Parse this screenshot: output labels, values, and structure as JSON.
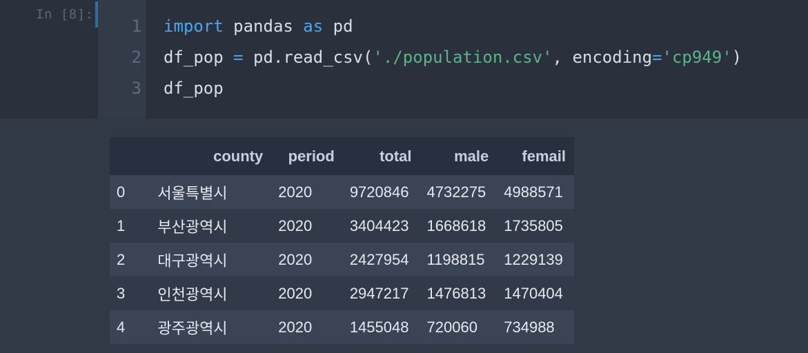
{
  "cell": {
    "prompt": "In [8]:",
    "line_numbers": [
      "1",
      "2",
      "3"
    ],
    "lines": [
      [
        {
          "t": "import",
          "c": "kw"
        },
        {
          "t": " pandas ",
          "c": "plain"
        },
        {
          "t": "as",
          "c": "kw"
        },
        {
          "t": " pd",
          "c": "plain"
        }
      ],
      [
        {
          "t": "df_pop ",
          "c": "plain"
        },
        {
          "t": "=",
          "c": "op"
        },
        {
          "t": " pd.read_csv(",
          "c": "plain"
        },
        {
          "t": "'./population.csv'",
          "c": "str"
        },
        {
          "t": ", encoding",
          "c": "plain"
        },
        {
          "t": "=",
          "c": "op"
        },
        {
          "t": "'cp949'",
          "c": "str"
        },
        {
          "t": ")",
          "c": "plain"
        }
      ],
      [
        {
          "t": "df_pop",
          "c": "plain"
        }
      ]
    ]
  },
  "output": {
    "columns": [
      "county",
      "period",
      "total",
      "male",
      "femail"
    ],
    "rows": [
      {
        "index": "0",
        "county": "서울특별시",
        "period": "2020",
        "total": "9720846",
        "male": "4732275",
        "femail": "4988571"
      },
      {
        "index": "1",
        "county": "부산광역시",
        "period": "2020",
        "total": "3404423",
        "male": "1668618",
        "femail": "1735805"
      },
      {
        "index": "2",
        "county": "대구광역시",
        "period": "2020",
        "total": "2427954",
        "male": "1198815",
        "femail": "1229139"
      },
      {
        "index": "3",
        "county": "인천광역시",
        "period": "2020",
        "total": "2947217",
        "male": "1476813",
        "femail": "1470404"
      },
      {
        "index": "4",
        "county": "광주광역시",
        "period": "2020",
        "total": "1455048",
        "male": "720060",
        "femail": "734988"
      }
    ]
  },
  "colors": {
    "keyword": "#4aa5f0",
    "string": "#59b585",
    "text": "#d8dee9",
    "cell_background": "#2b313c",
    "output_background": "#323946"
  }
}
